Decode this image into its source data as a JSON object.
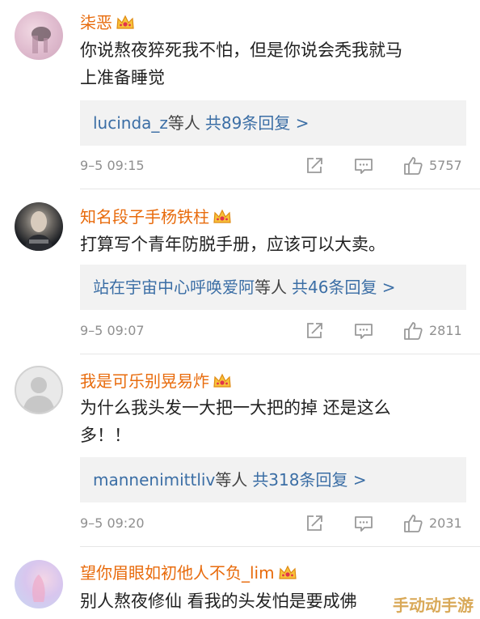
{
  "comments": [
    {
      "username": "柒恶",
      "text_lines": [
        "你说熬夜猝死我不怕，但是你说会秃我就马",
        "上准备睡觉"
      ],
      "reply_names": "lucinda_z",
      "reply_mid": "等人",
      "reply_count": "共89条回复 >",
      "time": "9–5 09:15",
      "likes": "5757"
    },
    {
      "username": "知名段子手杨铁柱",
      "text_lines": [
        "打算写个青年防脱手册，应该可以大卖。"
      ],
      "reply_names": "站在宇宙中心呼唤爱阿",
      "reply_mid": "等人",
      "reply_count": "共46条回复 >",
      "time": "9–5 09:07",
      "likes": "2811"
    },
    {
      "username": "我是可乐别晃易炸",
      "text_lines": [
        "为什么我头发一大把一大把的掉 还是这么",
        "多！！"
      ],
      "reply_names": "mannenimittliv",
      "reply_mid": "等人",
      "reply_count": "共318条回复 >",
      "time": "9–5 09:20",
      "likes": "2031"
    },
    {
      "username": "望你眉眼如初他人不负_lim",
      "text_lines": [
        "别人熬夜修仙 看我的头发怕是要成佛"
      ]
    }
  ],
  "icons": {
    "share": "share-icon",
    "comment": "comment-icon",
    "like": "thumbs-up-icon",
    "badge": "crown-badge-icon"
  },
  "colors": {
    "username": "#e86b0c",
    "reply_link": "#3b6ea5",
    "reply_bg": "#f2f2f2",
    "meta": "#8f8f8f"
  },
  "watermark": "手动动手游"
}
